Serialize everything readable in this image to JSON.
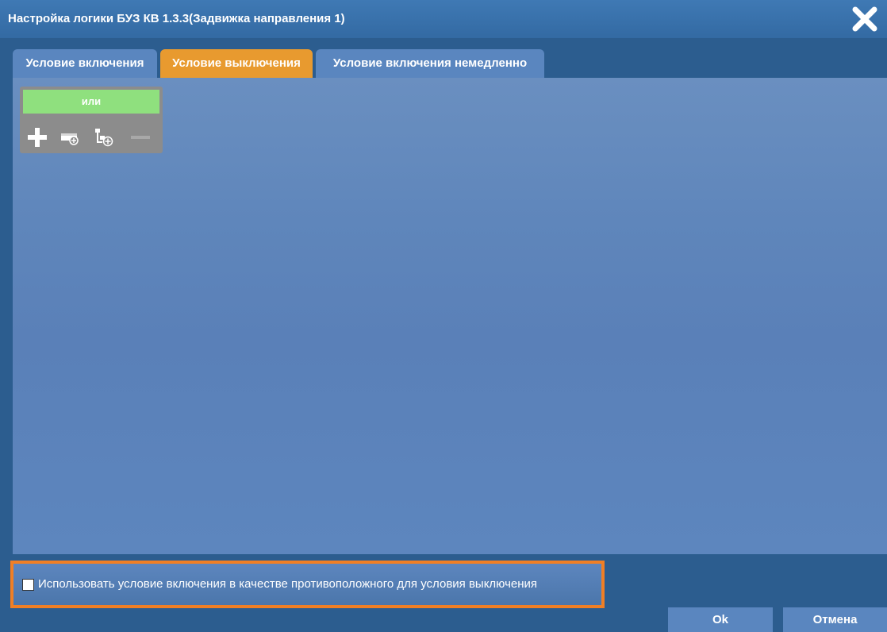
{
  "window": {
    "title": "Настройка логики БУЗ КВ 1.3.3(Задвижка направления 1)",
    "close_icon": "close-icon"
  },
  "tabs": [
    {
      "label": "Условие включения",
      "active": false
    },
    {
      "label": "Условие выключения",
      "active": true
    },
    {
      "label": "Условие включения немедленно",
      "active": false
    }
  ],
  "logic": {
    "operator_label": "или",
    "tools": [
      "plus-icon",
      "add-condition-icon",
      "add-group-icon",
      "minus-icon"
    ]
  },
  "option": {
    "label": "Использовать условие включения в качестве противоположного для условия выключения",
    "checked": false
  },
  "buttons": {
    "ok": "Ok",
    "cancel": "Отмена"
  },
  "colors": {
    "active_tab": "#e89a2f",
    "inactive_tab": "#5a86bf",
    "operator_button": "#8fe07e",
    "highlight_frame": "#f07f25"
  }
}
